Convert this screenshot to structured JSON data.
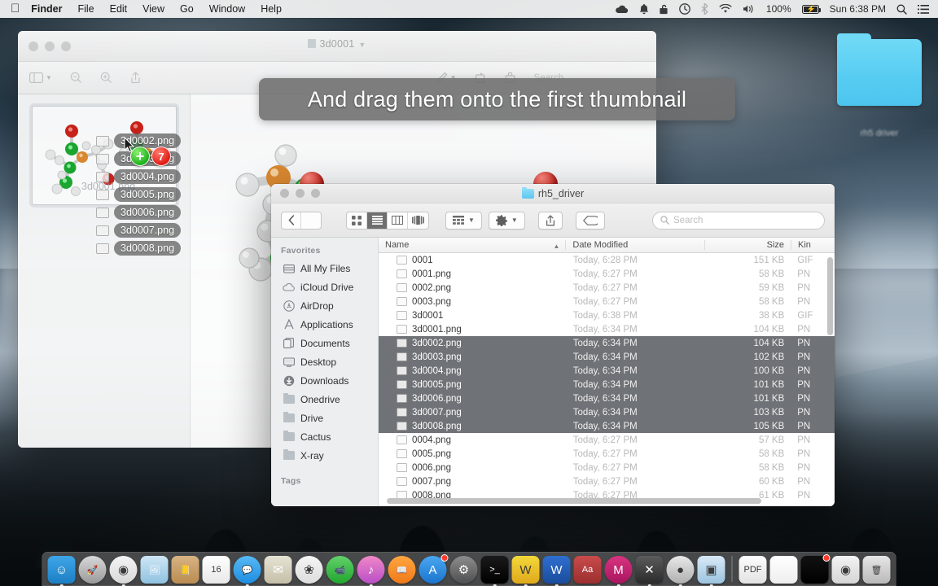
{
  "menubar": {
    "apple_icon": "apple-icon",
    "items": [
      {
        "label": "Finder",
        "bold": true
      },
      {
        "label": "File",
        "bold": false
      },
      {
        "label": "Edit",
        "bold": false
      },
      {
        "label": "View",
        "bold": false
      },
      {
        "label": "Go",
        "bold": false
      },
      {
        "label": "Window",
        "bold": false
      },
      {
        "label": "Help",
        "bold": false
      }
    ],
    "status": {
      "cloud_icon": "cloud-icon",
      "bell_icon": "bell-icon",
      "lock_icon": "lock-icon",
      "timemachine_icon": "time-machine-icon",
      "bluetooth_icon": "bluetooth-icon",
      "wifi_icon": "wifi-icon",
      "volume_icon": "volume-icon",
      "battery_percent": "100%",
      "battery_icon": "battery-charging-icon",
      "clock": "Sun 6:38 PM",
      "spotlight_icon": "search-icon",
      "notification_icon": "notification-center-icon"
    }
  },
  "preview_window": {
    "title": "3d0001",
    "title_chevron": "chevron-down-icon",
    "toolbar": {
      "sidebar_icon": "sidebar-toggle-icon",
      "zoom_out_icon": "zoom-out-icon",
      "zoom_in_icon": "zoom-in-icon",
      "share_icon": "share-icon",
      "markup_icon": "markup-pen-icon",
      "markup_chevron": "chevron-down-icon",
      "rotate_icon": "rotate-icon",
      "crop_icon": "crop-icon",
      "search_placeholder": "Search"
    },
    "thumbnail_alt": "3d molecular model thumbnail"
  },
  "drag_operation": {
    "labels": [
      "3d0002.png",
      "3d0003.png",
      "3d0004.png",
      "3d0005.png",
      "3d0006.png",
      "3d0007.png",
      "3d0008.png"
    ],
    "faded_label": "3d0001.png",
    "copy_badge": "+",
    "count_badge": "7",
    "cursor_icon": "arrow-cursor-icon"
  },
  "caption": {
    "text": "And drag them onto the first thumbnail"
  },
  "finder_window": {
    "title": "rh5_driver",
    "folder_icon": "folder-icon",
    "toolbar": {
      "back_icon": "back-chevron-icon",
      "forward_icon": "forward-chevron-icon",
      "view_icon_grid": "icon-view-icon",
      "view_list": "list-view-icon",
      "view_columns": "column-view-icon",
      "view_coverflow": "coverflow-view-icon",
      "arrange_icon": "arrange-by-icon",
      "arrange_chevron": "chevron-down-icon",
      "action_icon": "gear-icon",
      "action_chevron": "chevron-down-icon",
      "share_icon": "share-icon",
      "tag_icon": "tag-icon",
      "search_icon": "search-icon",
      "search_placeholder": "Search",
      "selected_view": "list-view-icon"
    },
    "sidebar": {
      "sections": [
        {
          "title": "Favorites",
          "items": [
            {
              "label": "All My Files",
              "icon": "all-my-files-icon"
            },
            {
              "label": "iCloud Drive",
              "icon": "icloud-icon"
            },
            {
              "label": "AirDrop",
              "icon": "airdrop-icon"
            },
            {
              "label": "Applications",
              "icon": "applications-icon"
            },
            {
              "label": "Documents",
              "icon": "documents-icon"
            },
            {
              "label": "Desktop",
              "icon": "desktop-icon"
            },
            {
              "label": "Downloads",
              "icon": "downloads-icon"
            },
            {
              "label": "Onedrive",
              "icon": "folder-icon"
            },
            {
              "label": "Drive",
              "icon": "folder-icon"
            },
            {
              "label": "Cactus",
              "icon": "folder-icon"
            },
            {
              "label": "X-ray",
              "icon": "folder-icon"
            }
          ]
        },
        {
          "title": "Tags",
          "items": []
        }
      ]
    },
    "columns": [
      {
        "key": "name",
        "label": "Name",
        "sorted": true,
        "sort_icon": "sort-ascending-icon"
      },
      {
        "key": "date",
        "label": "Date Modified"
      },
      {
        "key": "size",
        "label": "Size"
      },
      {
        "key": "kind",
        "label": "Kin"
      }
    ],
    "files": [
      {
        "name": "0001",
        "date": "Today, 6:28 PM",
        "size": "151 KB",
        "kind": "GIF",
        "selected": false
      },
      {
        "name": "0001.png",
        "date": "Today, 6:27 PM",
        "size": "58 KB",
        "kind": "PN",
        "selected": false
      },
      {
        "name": "0002.png",
        "date": "Today, 6:27 PM",
        "size": "59 KB",
        "kind": "PN",
        "selected": false
      },
      {
        "name": "0003.png",
        "date": "Today, 6:27 PM",
        "size": "58 KB",
        "kind": "PN",
        "selected": false
      },
      {
        "name": "3d0001",
        "date": "Today, 6:38 PM",
        "size": "38 KB",
        "kind": "GIF",
        "selected": false
      },
      {
        "name": "3d0001.png",
        "date": "Today, 6:34 PM",
        "size": "104 KB",
        "kind": "PN",
        "selected": false
      },
      {
        "name": "3d0002.png",
        "date": "Today, 6:34 PM",
        "size": "104 KB",
        "kind": "PN",
        "selected": true
      },
      {
        "name": "3d0003.png",
        "date": "Today, 6:34 PM",
        "size": "102 KB",
        "kind": "PN",
        "selected": true
      },
      {
        "name": "3d0004.png",
        "date": "Today, 6:34 PM",
        "size": "100 KB",
        "kind": "PN",
        "selected": true
      },
      {
        "name": "3d0005.png",
        "date": "Today, 6:34 PM",
        "size": "101 KB",
        "kind": "PN",
        "selected": true
      },
      {
        "name": "3d0006.png",
        "date": "Today, 6:34 PM",
        "size": "101 KB",
        "kind": "PN",
        "selected": true
      },
      {
        "name": "3d0007.png",
        "date": "Today, 6:34 PM",
        "size": "103 KB",
        "kind": "PN",
        "selected": true
      },
      {
        "name": "3d0008.png",
        "date": "Today, 6:34 PM",
        "size": "105 KB",
        "kind": "PN",
        "selected": true
      },
      {
        "name": "0004.png",
        "date": "Today, 6:27 PM",
        "size": "57 KB",
        "kind": "PN",
        "selected": false
      },
      {
        "name": "0005.png",
        "date": "Today, 6:27 PM",
        "size": "58 KB",
        "kind": "PN",
        "selected": false
      },
      {
        "name": "0006.png",
        "date": "Today, 6:27 PM",
        "size": "58 KB",
        "kind": "PN",
        "selected": false
      },
      {
        "name": "0007.png",
        "date": "Today, 6:27 PM",
        "size": "60 KB",
        "kind": "PN",
        "selected": false
      },
      {
        "name": "0008.png",
        "date": "Today, 6:27 PM",
        "size": "61 KB",
        "kind": "PN",
        "selected": false
      }
    ]
  },
  "desktop": {
    "folder_label": "rh5 driver"
  },
  "dock": {
    "items": [
      {
        "name": "finder",
        "color1": "#3ea5e8",
        "color2": "#1d7fc4",
        "glyph": "☺",
        "running": true,
        "circle": false
      },
      {
        "name": "launchpad",
        "color1": "#d8d8d8",
        "color2": "#9a9a9a",
        "glyph": "🚀",
        "running": false,
        "circle": true
      },
      {
        "name": "chrome",
        "color1": "#f4f4f4",
        "color2": "#d8d8d8",
        "glyph": "◉",
        "running": true,
        "circle": true
      },
      {
        "name": "preview",
        "color1": "#cfe6f5",
        "color2": "#8fc2e0",
        "glyph": "🖼",
        "running": false,
        "circle": false
      },
      {
        "name": "contacts",
        "color1": "#d8b383",
        "color2": "#b98c52",
        "glyph": "📒",
        "running": false,
        "circle": false
      },
      {
        "name": "calendar",
        "color1": "#ffffff",
        "color2": "#e8e8e8",
        "glyph": "16",
        "running": false,
        "circle": false
      },
      {
        "name": "messages",
        "color1": "#57b9f5",
        "color2": "#1d8de0",
        "glyph": "💬",
        "running": true,
        "circle": true
      },
      {
        "name": "mail",
        "color1": "#e7e3d4",
        "color2": "#c5bfa8",
        "glyph": "✉",
        "running": false,
        "circle": false
      },
      {
        "name": "photos",
        "color1": "#f5f5f5",
        "color2": "#dddddd",
        "glyph": "❀",
        "running": false,
        "circle": true
      },
      {
        "name": "facetime",
        "color1": "#62d16a",
        "color2": "#21a62e",
        "glyph": "📹",
        "running": false,
        "circle": true
      },
      {
        "name": "itunes",
        "color1": "#f188c7",
        "color2": "#b94ec7",
        "glyph": "♪",
        "running": true,
        "circle": true
      },
      {
        "name": "ibooks",
        "color1": "#ffa641",
        "color2": "#ef7a18",
        "glyph": "📖",
        "running": false,
        "circle": true
      },
      {
        "name": "app-store",
        "color1": "#4aa7f0",
        "color2": "#1b74cf",
        "glyph": "A",
        "running": false,
        "circle": true,
        "badge": true
      },
      {
        "name": "system-preferences",
        "color1": "#8d8d8d",
        "color2": "#4f4f4f",
        "glyph": "⚙",
        "running": false,
        "circle": true
      },
      {
        "name": "terminal",
        "color1": "#1a1a1a",
        "color2": "#000000",
        "glyph": ">_",
        "running": true,
        "circle": false
      },
      {
        "name": "mathematica",
        "color1": "#f2d83a",
        "color2": "#e0a91c",
        "glyph": "W",
        "running": true,
        "circle": false
      },
      {
        "name": "word",
        "color1": "#2f6fd0",
        "color2": "#1a4c9b",
        "glyph": "W",
        "running": true,
        "circle": false
      },
      {
        "name": "dictionary",
        "color1": "#c94b4b",
        "color2": "#9b2f2f",
        "glyph": "Aa",
        "running": false,
        "circle": false
      },
      {
        "name": "mendeley",
        "color1": "#d8347f",
        "color2": "#a91560",
        "glyph": "M",
        "running": true,
        "circle": true
      },
      {
        "name": "xcode",
        "color1": "#5b5b5b",
        "color2": "#2b2b2b",
        "glyph": "✕",
        "running": true,
        "circle": false
      },
      {
        "name": "avogadro",
        "color1": "#e8e8e8",
        "color2": "#b0b0b0",
        "glyph": "●",
        "running": true,
        "circle": true
      },
      {
        "name": "keynote",
        "color1": "#d9e9f6",
        "color2": "#9cc4e0",
        "glyph": "▣",
        "running": true,
        "circle": false
      },
      {
        "name": "pdf-document",
        "color1": "#fdfdfd",
        "color2": "#e2e2e2",
        "glyph": "PDF",
        "running": false,
        "circle": false
      },
      {
        "name": "blank-document",
        "color1": "#ffffff",
        "color2": "#eeeeee",
        "glyph": "",
        "running": false,
        "circle": false
      },
      {
        "name": "terminal-window",
        "color1": "#111111",
        "color2": "#000000",
        "glyph": "",
        "running": false,
        "circle": false,
        "badge": true
      },
      {
        "name": "chrome-window",
        "color1": "#f3f3f3",
        "color2": "#d5d5d5",
        "glyph": "◉",
        "running": false,
        "circle": false
      },
      {
        "name": "trash",
        "color1": "#e6e6e6",
        "color2": "#b9b9b9",
        "glyph": "🗑",
        "running": false,
        "circle": false
      }
    ]
  }
}
